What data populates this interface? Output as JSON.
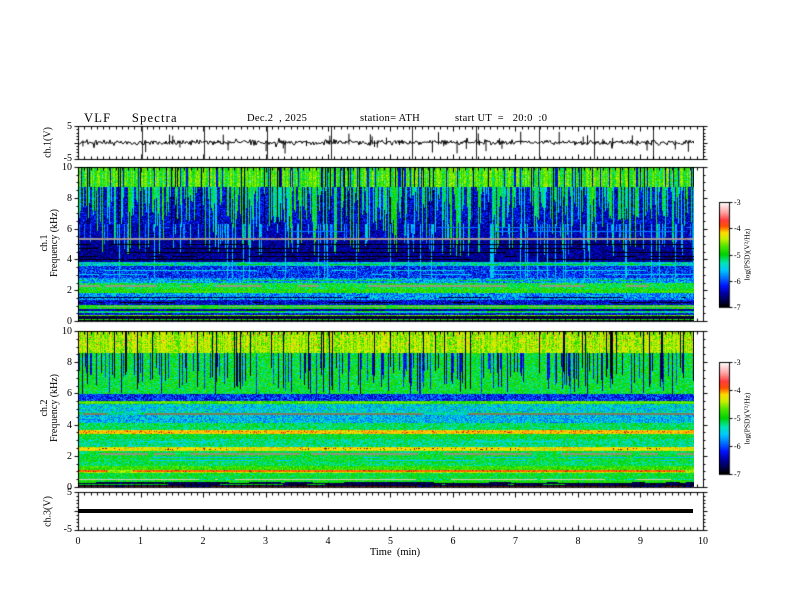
{
  "header": {
    "title": "VLF  Spectra",
    "date": "Dec.2  , 2025",
    "station": "station= ATH",
    "start_ut": "start UT  =   20:0  :0"
  },
  "xaxis": {
    "label": "Time  (min)",
    "ticks": [
      "0",
      "1",
      "2",
      "3",
      "4",
      "5",
      "6",
      "7",
      "8",
      "9",
      "10"
    ],
    "minor_step_min": 0.1,
    "range_min": [
      0,
      10
    ],
    "data_end_min": 9.86
  },
  "panels": {
    "waveform": {
      "ylabel": "ch.1(V)",
      "ytick_top": "5",
      "ytick_bottom": "-5",
      "yrange": [
        -5,
        5
      ]
    },
    "spec1": {
      "ylabel_line1": "ch.1",
      "ylabel_line2": "Frequency (kHz)",
      "yticks": [
        "10",
        "8",
        "6",
        "4",
        "2",
        "0"
      ],
      "yrange_khz": [
        0,
        10
      ]
    },
    "spec2": {
      "ylabel_line1": "ch.2",
      "ylabel_line2": "Frequency (kHz)",
      "yticks": [
        "10",
        "8",
        "6",
        "4",
        "2",
        "0"
      ],
      "yrange_khz": [
        0,
        10
      ]
    },
    "ch3": {
      "ylabel": "ch.3(V)",
      "ytick_top": "5",
      "ytick_bottom": "-5",
      "yrange": [
        -5,
        5
      ],
      "line_value_v": 0
    }
  },
  "colorbar": {
    "label": "log(PSD)(V²/Hz)",
    "ticks": [
      "-3",
      "-4",
      "-5",
      "-6",
      "-7"
    ],
    "range": [
      -7,
      -3
    ],
    "stops": [
      [
        0,
        "#000000"
      ],
      [
        0.06,
        "#000050"
      ],
      [
        0.13,
        "#0000a8"
      ],
      [
        0.2,
        "#0014ff"
      ],
      [
        0.28,
        "#0078ff"
      ],
      [
        0.35,
        "#00c8ff"
      ],
      [
        0.42,
        "#00e6b4"
      ],
      [
        0.5,
        "#00d200"
      ],
      [
        0.58,
        "#50e600"
      ],
      [
        0.65,
        "#c8f000"
      ],
      [
        0.71,
        "#ffdc00"
      ],
      [
        0.77,
        "#ff5000"
      ],
      [
        0.83,
        "#ff3c3c"
      ],
      [
        0.9,
        "#ff9e9e"
      ],
      [
        1,
        "#ffffff"
      ]
    ]
  },
  "chart_data": {
    "type": "heatmap",
    "title": "VLF Spectra multi-panel record",
    "xlabel": "Time (min)",
    "x_range_min": [
      0,
      10
    ],
    "z_units": "log(PSD)(V²/Hz)",
    "z_range": [
      -7,
      -3
    ],
    "panels": [
      {
        "id": "ch1_voltage",
        "type": "line",
        "units": "V",
        "y_range": [
          -5,
          5
        ],
        "baseline_v": 0,
        "noise_amp_v": 0.8,
        "spike_times_min": [
          1.02,
          2.01,
          3.02,
          4.04,
          5.35,
          6.36,
          7.37,
          8.25,
          9.2
        ]
      },
      {
        "id": "ch1_spectrogram",
        "type": "heatmap",
        "f_range_khz": [
          0,
          10
        ],
        "bands": [
          [
            0.0,
            0.08,
            -6.9,
            0.15
          ],
          [
            0.08,
            0.16,
            -4.9,
            0.3
          ],
          [
            0.16,
            0.3,
            -6.85,
            0.2
          ],
          [
            0.3,
            0.38,
            -4.7,
            0.3
          ],
          [
            0.38,
            0.5,
            -6.3,
            0.4
          ],
          [
            0.5,
            0.68,
            -5.3,
            0.4
          ],
          [
            0.68,
            0.8,
            -6.5,
            0.35
          ],
          [
            0.8,
            1.05,
            -4.95,
            0.3
          ],
          [
            1.05,
            1.35,
            -6.35,
            0.4
          ],
          [
            1.35,
            1.8,
            -5.75,
            0.5
          ],
          [
            1.8,
            2.1,
            -4.9,
            0.3
          ],
          [
            2.1,
            2.5,
            -5.05,
            0.4
          ],
          [
            2.5,
            2.8,
            -5.7,
            0.5
          ],
          [
            2.8,
            3.55,
            -6.15,
            0.45
          ],
          [
            3.55,
            3.8,
            -5.45,
            0.45
          ],
          [
            3.8,
            5.25,
            -6.55,
            0.3
          ],
          [
            5.25,
            6.3,
            -6.45,
            0.35
          ],
          [
            6.3,
            8.7,
            -6.35,
            0.4
          ],
          [
            8.7,
            10.01,
            -5.0,
            0.4
          ]
        ],
        "lines": [
          {
            "f": 5.32,
            "w": 2,
            "c": "#9e96a2",
            "p": 0.96,
            "dots": {
              "c": "#b04848",
              "p": 0.05
            }
          },
          {
            "f": 4.95,
            "w": 1,
            "v": -7,
            "p": 0.7
          },
          {
            "f": 4.7,
            "w": 1,
            "v": -7,
            "p": 0.65
          },
          {
            "f": 4.45,
            "w": 1,
            "v": -7,
            "p": 0.65
          },
          {
            "f": 4.2,
            "w": 1,
            "v": -7,
            "p": 0.6
          },
          {
            "f": 4.0,
            "w": 1,
            "v": -7,
            "p": 0.6
          },
          {
            "f": 3.7,
            "w": 1,
            "v": -5.0,
            "p": 0.45
          },
          {
            "f": 3.3,
            "w": 1,
            "v": -5.5,
            "p": 0.4
          },
          {
            "f": 3.05,
            "w": 1,
            "v": -5.55,
            "p": 0.4
          },
          {
            "f": 2.62,
            "w": 1,
            "v": -5.05,
            "p": 0.4
          },
          {
            "f": 2.3,
            "w": 2,
            "c": "#8e9c86",
            "p": 0.75
          },
          {
            "f": 1.93,
            "w": 1,
            "v": -4.7,
            "p": 0.45
          },
          {
            "f": 1.55,
            "w": 1,
            "v": -6.8,
            "p": 0.45
          },
          {
            "f": 1.2,
            "w": 1,
            "v": -7,
            "p": 0.6
          },
          {
            "f": 0.92,
            "w": 1,
            "c": "#9aa48a",
            "p": 0.8
          },
          {
            "f": 0.6,
            "w": 1,
            "v": -4.95,
            "p": 0.45
          },
          {
            "f": 6.05,
            "w": 1,
            "v": -5.9,
            "p": 0.3
          },
          {
            "f": 5.8,
            "w": 1,
            "v": -5.85,
            "p": 0.3
          }
        ],
        "streaks": {
          "kind": "s1",
          "bright_p": 0.58,
          "bright_v": -5.15,
          "top_band": 8.7,
          "bright_bot": [
            6.3,
            8.5
          ],
          "deep_p": 0.3,
          "deep_bot": [
            4.2,
            6.2
          ],
          "dark_p": 0.06,
          "cyan_p": 0.17,
          "cyan_top": 6.3,
          "cyan_bot": [
            4.3,
            5.9
          ],
          "cyan_v": -5.7,
          "thin_p": 0.05,
          "top_bright_p": 0.5,
          "top_bright_v": -4.6,
          "top_dark_p": 0.12,
          "top_dark_v": -6.3
        }
      },
      {
        "id": "ch2_spectrogram",
        "type": "heatmap",
        "f_range_khz": [
          0,
          10
        ],
        "bands": [
          [
            0.0,
            0.06,
            -6.6,
            0.3
          ],
          [
            0.06,
            0.34,
            -6.8,
            0.3
          ],
          [
            0.34,
            0.44,
            -4.95,
            0.3
          ],
          [
            0.44,
            0.52,
            -5.3,
            0.4
          ],
          [
            0.52,
            0.92,
            -5.05,
            0.3
          ],
          [
            0.92,
            1.08,
            -4.5,
            0.3
          ],
          [
            1.08,
            1.32,
            -4.8,
            0.25
          ],
          [
            1.32,
            1.62,
            -5.15,
            0.35
          ],
          [
            1.62,
            2.02,
            -5.05,
            0.3
          ],
          [
            2.02,
            2.28,
            -5.1,
            0.3
          ],
          [
            2.28,
            2.58,
            -4.3,
            0.3
          ],
          [
            2.58,
            3.08,
            -5.25,
            0.35
          ],
          [
            3.08,
            3.42,
            -5.05,
            0.3
          ],
          [
            3.42,
            3.68,
            -4.2,
            0.3
          ],
          [
            3.68,
            4.12,
            -5.15,
            0.35
          ],
          [
            4.12,
            4.62,
            -5.6,
            0.45
          ],
          [
            4.62,
            4.82,
            -5.35,
            0.4
          ],
          [
            4.82,
            5.32,
            -5.5,
            0.45
          ],
          [
            5.32,
            5.52,
            -4.8,
            0.3
          ],
          [
            5.52,
            5.98,
            -6.15,
            0.45
          ],
          [
            5.98,
            8.6,
            -5.05,
            0.35
          ],
          [
            8.6,
            10.01,
            -4.6,
            0.35
          ]
        ],
        "lines": [
          {
            "f": 0.03,
            "w": 1,
            "c": "#5a1414",
            "p": 0.55
          },
          {
            "f": 0.14,
            "w": 1,
            "v": -5.0,
            "p": 0.4
          },
          {
            "f": 0.26,
            "w": 1,
            "v": -4.9,
            "p": 0.35
          },
          {
            "f": 0.48,
            "w": 1,
            "c": "#c9cdb6",
            "p": 0.85
          },
          {
            "f": 1.0,
            "w": 2,
            "v": -3.95,
            "p": 0.85,
            "dots": {
              "c": "#8a2a10",
              "p": 0.08
            }
          },
          {
            "f": 1.72,
            "w": 1,
            "v": -5.6,
            "p": 0.5
          },
          {
            "f": 1.88,
            "w": 1,
            "v": -5.65,
            "p": 0.45
          },
          {
            "f": 2.14,
            "w": 2,
            "c": "#8f9478",
            "p": 0.7
          },
          {
            "f": 2.42,
            "w": 2,
            "v": -4.2,
            "p": 0.85,
            "dots": {
              "c": "#70200c",
              "p": 0.12
            }
          },
          {
            "f": 2.9,
            "w": 1,
            "v": -5.5,
            "p": 0.3
          },
          {
            "f": 3.52,
            "w": 2,
            "v": -4.1,
            "p": 0.9,
            "dots": {
              "c": "#c03010",
              "p": 0.1
            }
          },
          {
            "f": 4.71,
            "w": 2,
            "c": "#7d7d5c",
            "p": 0.75
          },
          {
            "f": 5.41,
            "w": 1,
            "v": -4.6,
            "p": 0.6
          }
        ],
        "streaks": {
          "kind": "s2",
          "blue_p": 0.28,
          "blue_v": -6.35,
          "blue_top": 8.6,
          "blue_bot": [
            5.9,
            7.7
          ],
          "black_p": 0.07,
          "black_bot": [
            6.2,
            7.7
          ],
          "top_band": 8.6,
          "top_bright_p": 0.45,
          "top_bright_v": -4.4,
          "red_dot_p": 0.03,
          "red_dot_above": 9.0,
          "red_dot_v": -3.6
        }
      },
      {
        "id": "ch3_voltage",
        "type": "line",
        "units": "V",
        "y_range": [
          -5,
          5
        ],
        "value_v": 0,
        "flat": true,
        "data_end_min": 9.85
      }
    ]
  }
}
